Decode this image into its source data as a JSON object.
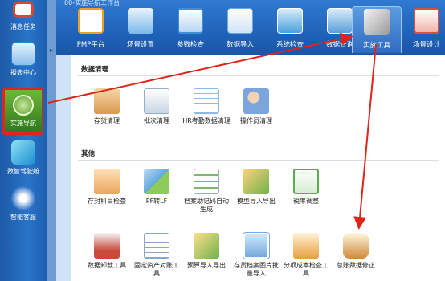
{
  "sidebar": {
    "items": [
      {
        "label": "消息任务",
        "icon": "message-icon",
        "color": "#d9482b"
      },
      {
        "label": "报表中心",
        "icon": "report-icon",
        "color": "#2a84d6"
      },
      {
        "label": "实施导航",
        "icon": "navigation-icon",
        "color": "#4d9a28"
      },
      {
        "label": "数智驾驶舱",
        "icon": "cockpit-icon",
        "color": "#23a6d8"
      },
      {
        "label": "智能客服",
        "icon": "service-icon",
        "color": "#3273c9"
      }
    ]
  },
  "app": {
    "title": "00-实施导航工作台"
  },
  "toolbar": {
    "items": [
      {
        "label": "PMP平台",
        "icon": "pmp-icon",
        "color": "#f0a020"
      },
      {
        "label": "场景设置",
        "icon": "scene-icon",
        "color": "#4aa3e0"
      },
      {
        "label": "参数检查",
        "icon": "checklist-icon",
        "color": "#3f8fd8"
      },
      {
        "label": "数据导入",
        "icon": "data-import-icon",
        "color": "#6aa8e6"
      },
      {
        "label": "系统检查",
        "icon": "system-check-icon",
        "color": "#49a0dd"
      },
      {
        "label": "数据查询",
        "icon": "data-query-icon",
        "color": "#5a9ed8"
      },
      {
        "label": "实施工具",
        "icon": "tools-icon",
        "color": "#d6d6d6"
      },
      {
        "label": "场景设计",
        "icon": "scene-design-icon",
        "color": "#e24c3a"
      }
    ]
  },
  "sections": {
    "cleanup": {
      "title": "数据清理",
      "tools": [
        {
          "label": "存货清理",
          "icon": "inventory-clean-icon",
          "color": "#d99a4e"
        },
        {
          "label": "批次清理",
          "icon": "batch-clean-icon",
          "color": "#c9d6e5"
        },
        {
          "label": "HR考勤数据清理",
          "icon": "hr-clean-icon",
          "color": "#8fb8e4"
        },
        {
          "label": "操作员清理",
          "icon": "operator-clean-icon",
          "color": "#7aa6dc"
        }
      ]
    },
    "other": {
      "title": "其他",
      "tools": [
        {
          "label": "存封科目检查",
          "icon": "account-check-icon",
          "color": "#e9a55c"
        },
        {
          "label": "PF转LF",
          "icon": "pf-to-lf-icon",
          "color": "#63a7e0"
        },
        {
          "label": "档案助记码自动生成",
          "icon": "mnemonic-icon",
          "color": "#7ab86a"
        },
        {
          "label": "模型导入导出",
          "icon": "model-io-icon",
          "color": "#6fb24b"
        },
        {
          "label": "税率调整",
          "icon": "tax-rate-icon",
          "color": "#5cab4e"
        },
        {
          "label": "数据卸载工具",
          "icon": "data-unload-icon",
          "color": "#c84a3a"
        },
        {
          "label": "固定资产对账工具",
          "icon": "asset-reconcile-icon",
          "color": "#8aa6c8"
        },
        {
          "label": "预算导入导出",
          "icon": "budget-io-icon",
          "color": "#6fb24b"
        },
        {
          "label": "存货档案图片批量导入",
          "icon": "image-import-icon",
          "color": "#73a9dd"
        },
        {
          "label": "分项成本检查工具",
          "icon": "cost-check-icon",
          "color": "#e6a040"
        },
        {
          "label": "总账数据修正",
          "icon": "ledger-fix-icon",
          "color": "#d08a3a"
        }
      ]
    }
  }
}
